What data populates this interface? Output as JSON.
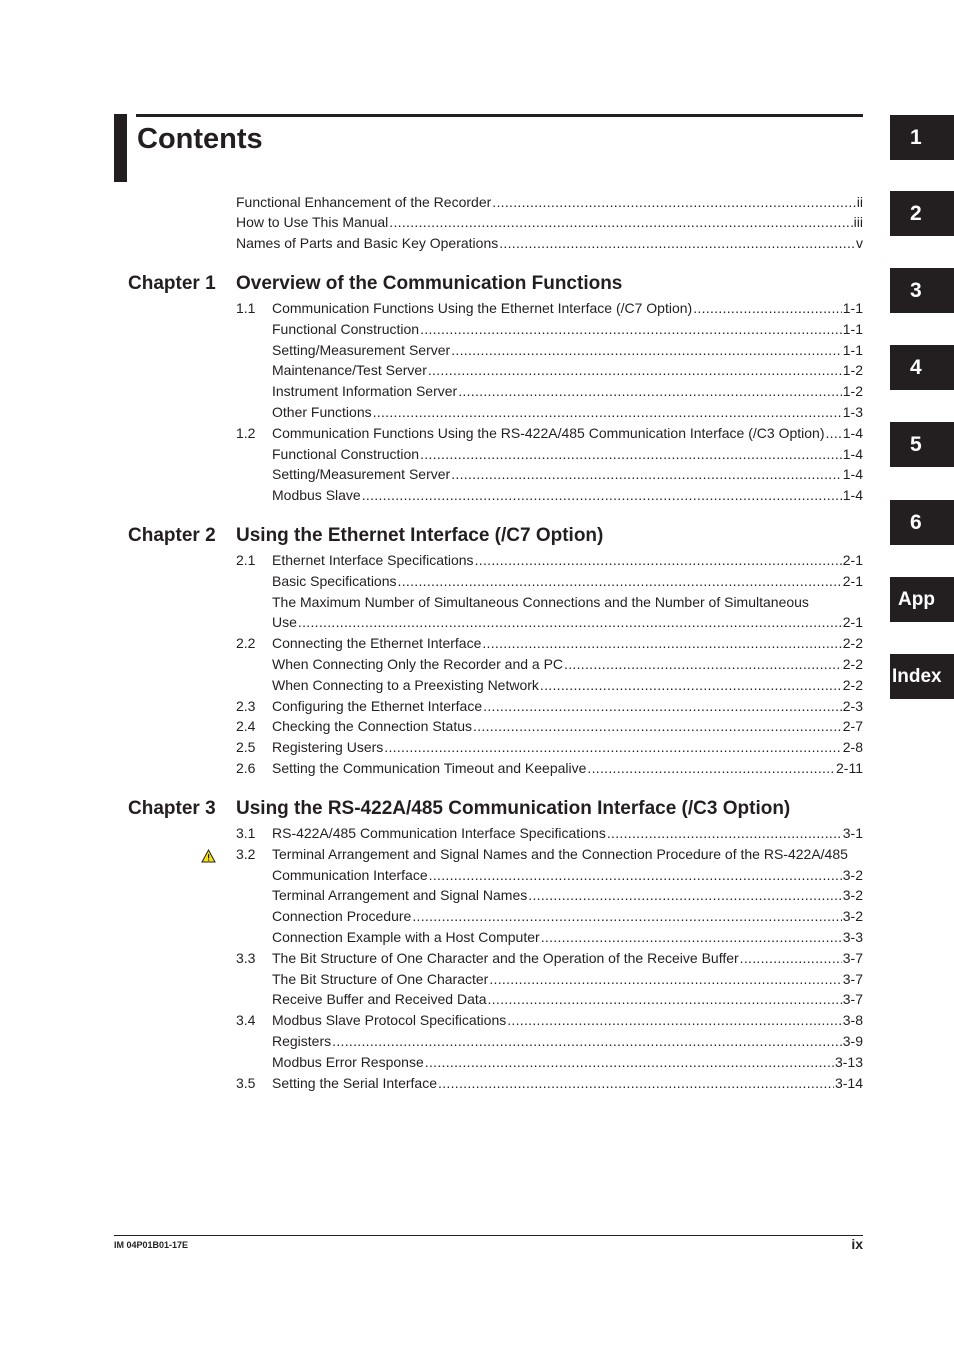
{
  "page": {
    "title": "Contents",
    "footer_code": "IM 04P01B01-17E",
    "footer_page": "ix"
  },
  "tabs": [
    "1",
    "2",
    "3",
    "4",
    "5",
    "6",
    "App",
    "Index"
  ],
  "front_matter": [
    {
      "label": "Functional Enhancement of the Recorder",
      "page": "ii"
    },
    {
      "label": "How to Use This Manual",
      "page": "iii"
    },
    {
      "label": "Names of Parts and Basic Key Operations",
      "page": "v"
    }
  ],
  "chapters": [
    {
      "label": "Chapter 1",
      "title": "Overview of the Communication Functions",
      "entries": [
        {
          "num": "1.1",
          "label": "Communication Functions Using the Ethernet Interface (/C7 Option)",
          "page": "1-1"
        },
        {
          "num": "",
          "label": "Functional Construction",
          "page": "1-1"
        },
        {
          "num": "",
          "label": "Setting/Measurement Server",
          "page": "1-1"
        },
        {
          "num": "",
          "label": "Maintenance/Test Server",
          "page": "1-2"
        },
        {
          "num": "",
          "label": "Instrument Information Server",
          "page": "1-2"
        },
        {
          "num": "",
          "label": "Other Functions",
          "page": "1-3"
        },
        {
          "num": "1.2",
          "label": "Communication Functions Using the RS-422A/485 Communication Interface (/C3 Option)",
          "page": "1-4"
        },
        {
          "num": "",
          "label": "Functional Construction",
          "page": "1-4"
        },
        {
          "num": "",
          "label": "Setting/Measurement Server",
          "page": "1-4"
        },
        {
          "num": "",
          "label": "Modbus Slave",
          "page": "1-4"
        }
      ]
    },
    {
      "label": "Chapter 2",
      "title": "Using the Ethernet Interface (/C7 Option)",
      "entries": [
        {
          "num": "2.1",
          "label": "Ethernet Interface Specifications",
          "page": "2-1"
        },
        {
          "num": "",
          "label": "Basic Specifications",
          "page": "2-1"
        },
        {
          "num": "",
          "label": "The Maximum Number of Simultaneous Connections and the Number of Simultaneous",
          "page": ""
        },
        {
          "num": "",
          "label": "Use",
          "page": "2-1"
        },
        {
          "num": "2.2",
          "label": "Connecting the Ethernet Interface",
          "page": "2-2"
        },
        {
          "num": "",
          "label": "When Connecting Only the Recorder and a PC",
          "page": "2-2"
        },
        {
          "num": "",
          "label": "When Connecting to a Preexisting Network",
          "page": "2-2"
        },
        {
          "num": "2.3",
          "label": "Configuring the Ethernet Interface",
          "page": "2-3"
        },
        {
          "num": "2.4",
          "label": "Checking the Connection Status",
          "page": "2-7"
        },
        {
          "num": "2.5",
          "label": "Registering Users",
          "page": "2-8"
        },
        {
          "num": "2.6",
          "label": "Setting the Communication Timeout and Keepalive",
          "page": "2-11"
        }
      ]
    },
    {
      "label": "Chapter 3",
      "title": "Using the RS-422A/485 Communication Interface (/C3 Option)",
      "entries": [
        {
          "num": "3.1",
          "label": "RS-422A/485 Communication Interface Specifications",
          "page": "3-1"
        },
        {
          "num": "3.2",
          "label": "Terminal Arrangement and Signal Names and the Connection Procedure of the RS-422A/485",
          "page": "",
          "warning": true
        },
        {
          "num": "",
          "label": "Communication Interface",
          "page": "3-2"
        },
        {
          "num": "",
          "label": "Terminal Arrangement and Signal Names",
          "page": "3-2"
        },
        {
          "num": "",
          "label": "Connection Procedure",
          "page": "3-2"
        },
        {
          "num": "",
          "label": "Connection Example with a Host Computer",
          "page": "3-3"
        },
        {
          "num": "3.3",
          "label": "The Bit Structure of One Character and the Operation of the Receive Buffer",
          "page": "3-7"
        },
        {
          "num": "",
          "label": "The Bit Structure of One Character",
          "page": "3-7"
        },
        {
          "num": "",
          "label": "Receive Buffer and Received Data",
          "page": "3-7"
        },
        {
          "num": "3.4",
          "label": "Modbus Slave Protocol Specifications",
          "page": "3-8"
        },
        {
          "num": "",
          "label": "Registers",
          "page": "3-9"
        },
        {
          "num": "",
          "label": "Modbus Error Response",
          "page": "3-13"
        },
        {
          "num": "3.5",
          "label": "Setting the Serial Interface",
          "page": "3-14"
        }
      ]
    }
  ],
  "icons": {
    "warning": "warning-triangle-icon",
    "warning_color": "#f5e11a"
  }
}
